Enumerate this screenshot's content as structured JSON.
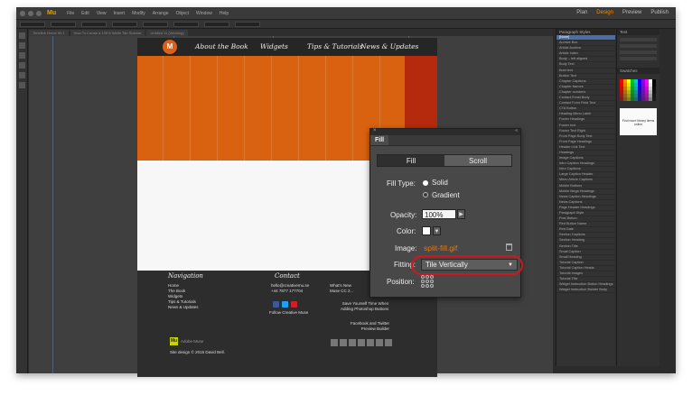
{
  "app": {
    "logo": "Mu",
    "menu": [
      "File",
      "Edit",
      "View",
      "Insert",
      "Modify",
      "Arrange",
      "Object",
      "Window",
      "Help"
    ],
    "modes": [
      "Plan",
      "Design",
      "Preview",
      "Publish"
    ],
    "accent": "#f08c00"
  },
  "tabs": [
    "Timeline Home 99.1",
    "How To Create a 100% Width Tab Sidebar",
    "Untitled 11 (Working)"
  ],
  "page": {
    "nav_logo": "M",
    "nav_links": [
      "About the Book",
      "Widgets",
      "Tips & Tutorials",
      "News & Updates"
    ],
    "hero_color": "#d8620f",
    "hero_accent": "#b52a0c",
    "footer": {
      "nav_heading": "Navigation",
      "nav_items": [
        "Home",
        "The Book",
        "Widgets",
        "Tips & Tutorials",
        "News & Updates"
      ],
      "contact_heading": "Contact",
      "contact_email": "hello@creativemu.se",
      "contact_phone": "+44 7877 177704",
      "follow": "Follow Creative Muse",
      "whats_new": "What's New",
      "muse_cc": "Muse CC 2...",
      "save_line1": "Save Yourself Time When",
      "save_line2": "Adding Photoshop Buttons",
      "fb_line1": "Facebook and Twitter",
      "fb_line2": "Preview Builder",
      "adobe_muse": "Adobe Muse",
      "site_design": "Site design © 2015 David Bell."
    }
  },
  "fill_dialog": {
    "close": "×",
    "collapse": "«",
    "title": "Fill",
    "tab_fill": "Fill",
    "tab_scroll": "Scroll",
    "fill_type_label": "Fill Type:",
    "fill_solid": "Solid",
    "fill_gradient": "Gradient",
    "opacity_label": "Opacity:",
    "opacity_value": "100%",
    "color_label": "Color:",
    "image_label": "Image:",
    "image_name": "split-fill.gif",
    "fitting_label": "Fitting:",
    "fitting_value": "Tile Vertically",
    "position_label": "Position:",
    "highlight_color": "#d0171e"
  },
  "paragraph_styles": {
    "header": "Paragraph Styles",
    "items": [
      "[None]",
      "Archive Box",
      "Article Archive",
      "Article Index",
      "Body – left aligned",
      "Body Text",
      "Bold text",
      "Button Text",
      "Chapter Captions",
      "Chapter Names",
      "Chapter numbers",
      "Contact Email Body",
      "Contact Form Field Text",
      "CTA Button",
      "Heading Menu Label",
      "Footer Headings",
      "Footer text",
      "Footer Text Right",
      "Front Page Body Text",
      "Front Page Headings",
      "Header Link Text",
      "Headings",
      "Image Captions",
      "Intro Caption Headings",
      "Intro Captions",
      "Large Caption Header",
      "Menu Article Captions",
      "Mobile Buttons",
      "Mobile Mega Headings",
      "News Caption Headings",
      "News Captions",
      "Page Header Headings",
      "Paragraph Style",
      "Post Button",
      "Red Button Name",
      "Red Date",
      "Section Captions",
      "Section Heading",
      "Section Title",
      "Small Caption",
      "Small Heading",
      "Tutorial Caption",
      "Tutorial Caption Heads",
      "Tutorial Images",
      "Tutorial Title",
      "Widget Instruction Button Headings",
      "Widget Instruction Builder Body"
    ]
  },
  "right_panel": {
    "header": "Text",
    "swatches_header": "Swatches",
    "library_text": "Find more library items online"
  }
}
